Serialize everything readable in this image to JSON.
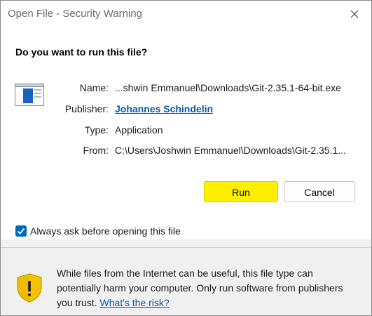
{
  "window": {
    "title": "Open File - Security Warning",
    "close_icon": "close-icon"
  },
  "question": "Do you want to run this file?",
  "file_icon": "application-window-icon",
  "details": {
    "name_label": "Name:",
    "name_value": "...shwin Emmanuel\\Downloads\\Git-2.35.1-64-bit.exe",
    "publisher_label": "Publisher:",
    "publisher_value": "Johannes Schindelin",
    "type_label": "Type:",
    "type_value": "Application",
    "from_label": "From:",
    "from_value": "C:\\Users\\Joshwin Emmanuel\\Downloads\\Git-2.35.1..."
  },
  "buttons": {
    "run": "Run",
    "cancel": "Cancel"
  },
  "checkbox": {
    "label": "Always ask before opening this file",
    "checked": true
  },
  "warning": {
    "text": "While files from the Internet can be useful, this file type can potentially harm your computer. Only run software from publishers you trust.",
    "link": "What's the risk?",
    "icon": "warning-shield-icon"
  },
  "colors": {
    "run_button": "#fff000",
    "link": "#0b57a8",
    "checkbox": "#0067c0",
    "shield_yellow": "#f5c400"
  }
}
